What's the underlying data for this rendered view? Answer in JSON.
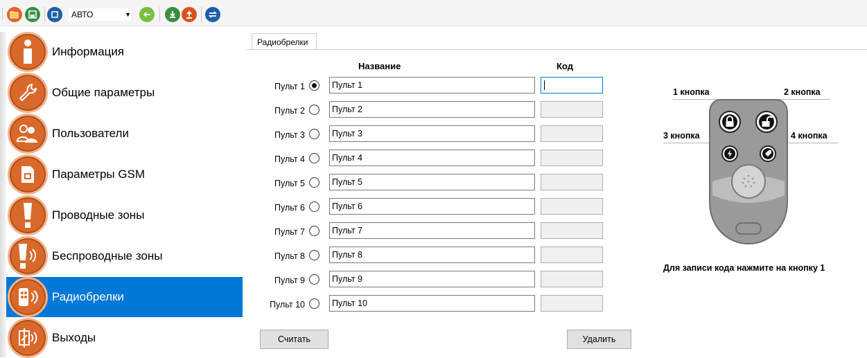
{
  "toolbar": {
    "mode_value": "АВТО",
    "buttons": [
      "open-icon",
      "save-icon",
      "sync-icon",
      "download-icon",
      "upload-icon",
      "refresh-icon"
    ]
  },
  "sidebar": {
    "items": [
      {
        "label": "Информация",
        "icon": "info-icon"
      },
      {
        "label": "Общие параметры",
        "icon": "wrench-icon"
      },
      {
        "label": "Пользователи",
        "icon": "users-icon"
      },
      {
        "label": "Параметры GSM",
        "icon": "sim-icon"
      },
      {
        "label": "Проводные зоны",
        "icon": "alert-icon"
      },
      {
        "label": "Беспроводные зоны",
        "icon": "wireless-alert-icon"
      },
      {
        "label": "Радиобрелки",
        "icon": "keyfob-icon",
        "active": true
      },
      {
        "label": "Выходы",
        "icon": "relay-icon"
      }
    ],
    "active_color": "#0078d7",
    "icon_color": "#d9692b"
  },
  "tab": {
    "label": "Радиобрелки"
  },
  "table": {
    "header_name": "Название",
    "header_code": "Код",
    "rows": [
      {
        "label": "Пульт 1",
        "name": "Пульт 1",
        "code": "",
        "selected": true
      },
      {
        "label": "Пульт 2",
        "name": "Пульт 2",
        "code": ""
      },
      {
        "label": "Пульт 3",
        "name": "Пульт 3",
        "code": ""
      },
      {
        "label": "Пульт 4",
        "name": "Пульт 4",
        "code": ""
      },
      {
        "label": "Пульт 5",
        "name": "Пульт 5",
        "code": ""
      },
      {
        "label": "Пульт 6",
        "name": "Пульт 6",
        "code": ""
      },
      {
        "label": "Пульт 7",
        "name": "Пульт 7",
        "code": ""
      },
      {
        "label": "Пульт 8",
        "name": "Пульт 8",
        "code": ""
      },
      {
        "label": "Пульт 9",
        "name": "Пульт 9",
        "code": ""
      },
      {
        "label": "Пульт 10",
        "name": "Пульт 10",
        "code": ""
      }
    ]
  },
  "buttons": {
    "read": "Считать",
    "delete": "Удалить"
  },
  "fob": {
    "button1": "1 кнопка",
    "button2": "2 кнопка",
    "button3": "3 кнопка",
    "button4": "4 кнопка",
    "caption": "Для записи кода нажмите на кнопку 1"
  }
}
